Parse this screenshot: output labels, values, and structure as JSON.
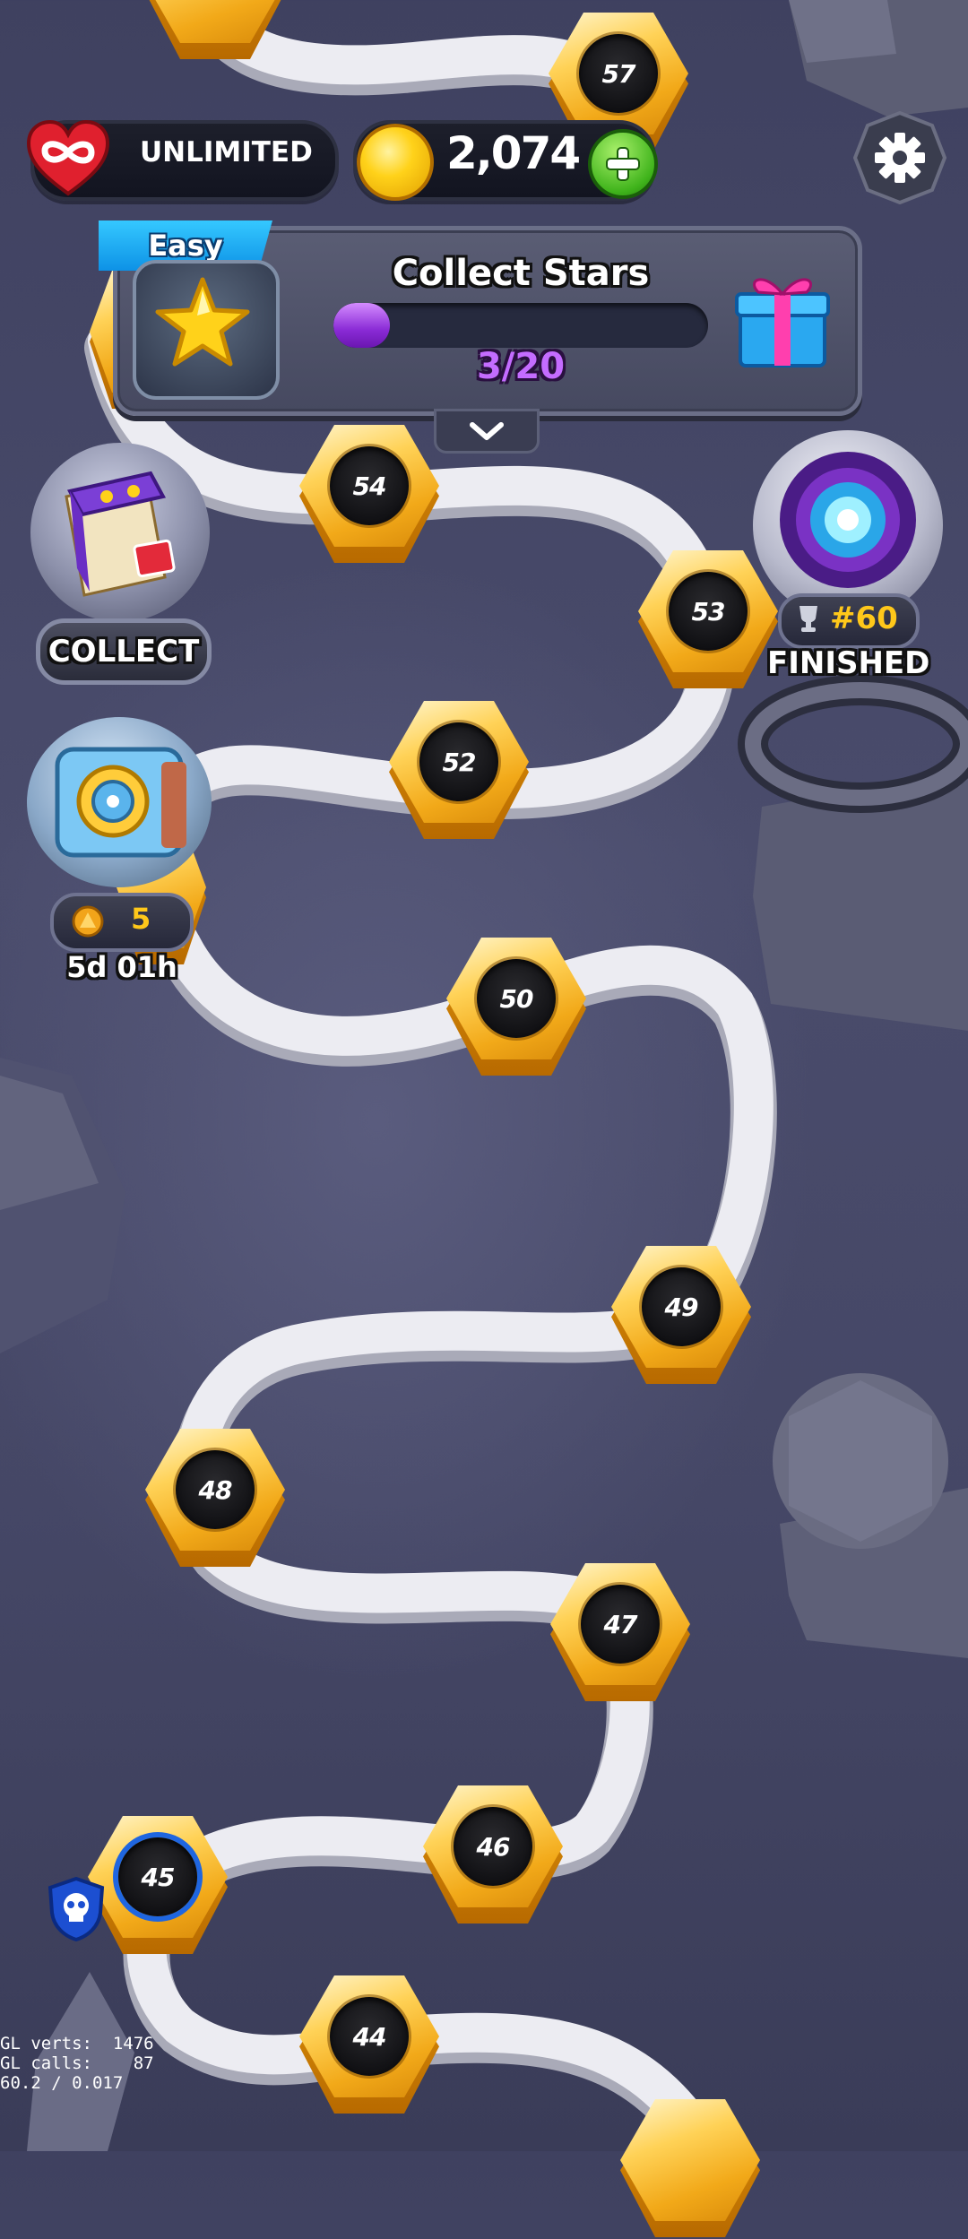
{
  "top_bar": {
    "lives_label": "UNLIMITED",
    "coins": "2,074"
  },
  "quest": {
    "difficulty": "Easy",
    "title": "Collect Stars",
    "progress_text": "3/20",
    "progress_fraction": 0.15
  },
  "side_events": {
    "collect_label": "COLLECT",
    "chest_cost": "5",
    "chest_timer": "5d 01h",
    "rank": "#60",
    "rank_status": "FINISHED"
  },
  "levels": [
    {
      "number": "57"
    },
    {
      "number": "54"
    },
    {
      "number": "53"
    },
    {
      "number": "52"
    },
    {
      "number": "50"
    },
    {
      "number": "49"
    },
    {
      "number": "48"
    },
    {
      "number": "47"
    },
    {
      "number": "46"
    },
    {
      "number": "45",
      "current": true
    },
    {
      "number": "44"
    }
  ],
  "debug": {
    "line1": "GL verts:  1476",
    "line2": "GL calls:    87",
    "line3": "60.2 / 0.017"
  },
  "colors": {
    "accent_purple": "#9b3fe6",
    "coin_gold": "#ffd21a",
    "path": "#e9e9ee",
    "tab_blue": "#19a6f0"
  },
  "icons": [
    "heart-infinity-icon",
    "coin-icon",
    "plus-icon",
    "gear-icon",
    "star-icon",
    "gift-icon",
    "chevron-down-icon",
    "book-icon",
    "vault-icon",
    "portal-icon",
    "trophy-icon",
    "skull-shield-icon"
  ]
}
